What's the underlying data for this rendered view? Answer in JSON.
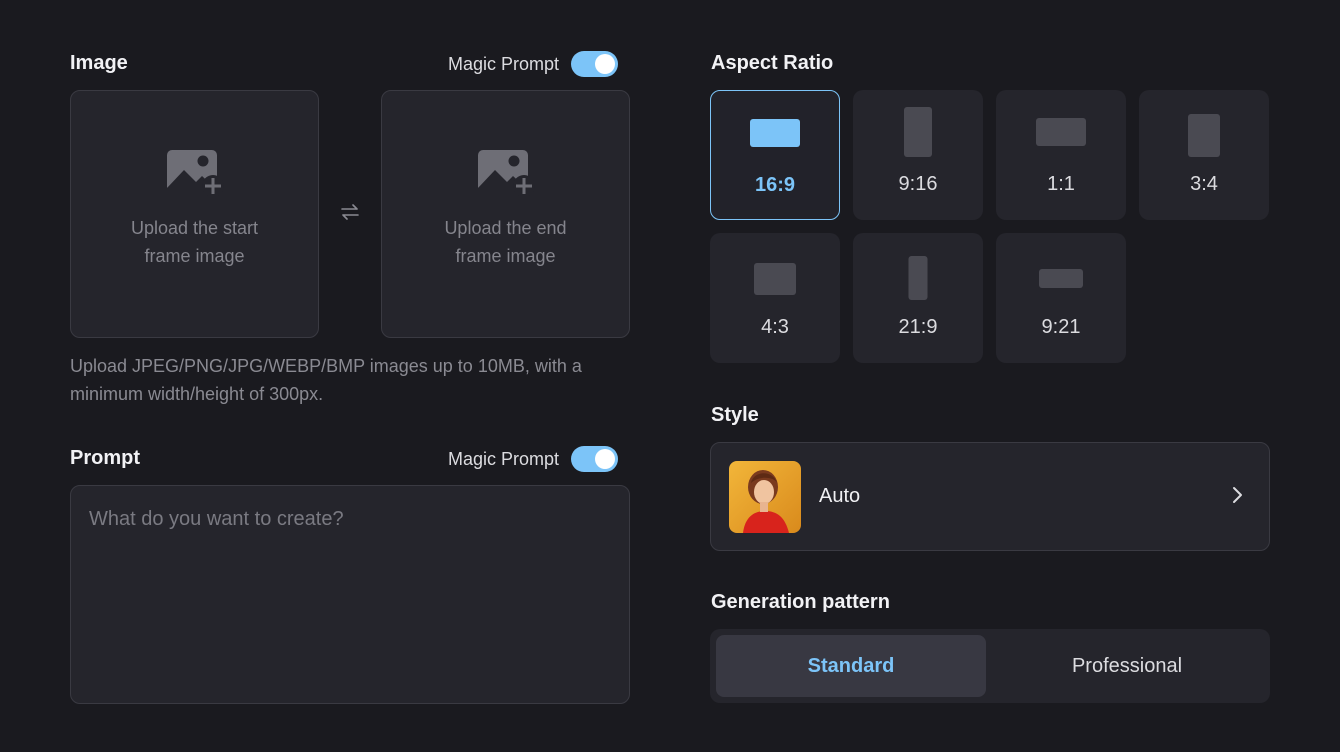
{
  "image_section": {
    "title": "Image",
    "magic_prompt_label": "Magic Prompt",
    "magic_prompt_on": true,
    "start_upload_text": "Upload the start frame image",
    "end_upload_text": "Upload the end frame image",
    "upload_icon": "image-add-icon",
    "swap_icon": "swap-icon",
    "hint": "Upload JPEG/PNG/JPG/WEBP/BMP images up to 10MB, with a minimum width/height of 300px."
  },
  "prompt_section": {
    "title": "Prompt",
    "magic_prompt_label": "Magic Prompt",
    "magic_prompt_on": true,
    "placeholder": "What do you want to create?",
    "value": ""
  },
  "aspect_ratio": {
    "title": "Aspect Ratio",
    "selected": "16:9",
    "options": [
      {
        "label": "16:9"
      },
      {
        "label": "9:16"
      },
      {
        "label": "1:1"
      },
      {
        "label": "3:4"
      },
      {
        "label": "4:3"
      },
      {
        "label": "21:9"
      },
      {
        "label": "9:21"
      }
    ]
  },
  "style": {
    "title": "Style",
    "selected_label": "Auto",
    "chevron_icon": "chevron-right-icon"
  },
  "generation_pattern": {
    "title": "Generation pattern",
    "options": [
      "Standard",
      "Professional"
    ],
    "selected": "Standard"
  },
  "colors": {
    "accent": "#7cc4f8",
    "background": "#1a1a1f",
    "panel": "#25252c"
  }
}
